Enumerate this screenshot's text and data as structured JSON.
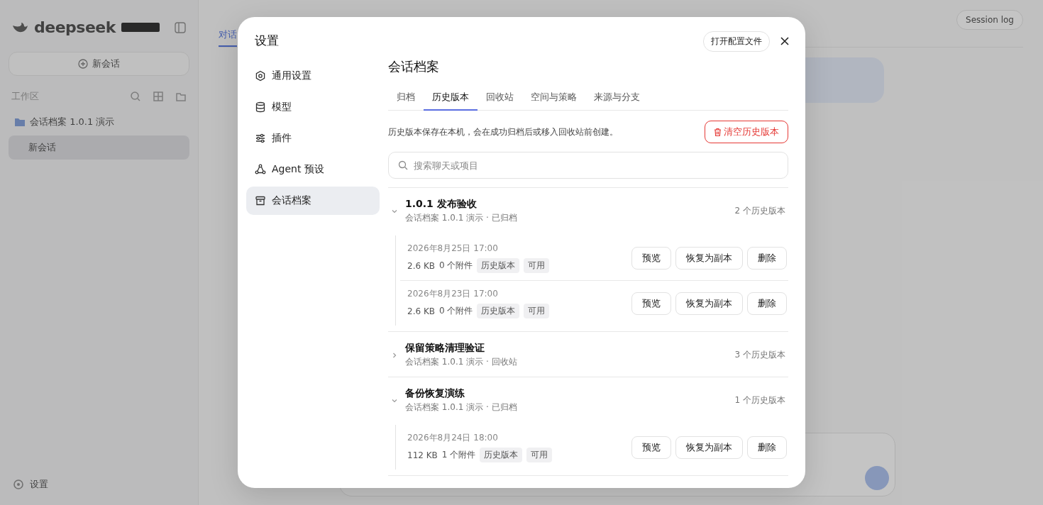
{
  "background": {
    "sidebar": {
      "brand": "deepseek",
      "new_chat": "新会话",
      "workspace_label": "工作区",
      "project": "会话档案 1.0.1 演示",
      "chats": [
        {
          "title": "新会话",
          "selected": true
        }
      ],
      "settings": "设置"
    },
    "main": {
      "tabs": [
        {
          "label": "对话",
          "selected": true
        }
      ],
      "session_log": "Session log"
    }
  },
  "dialog": {
    "title": "设置",
    "open_config": "打开配置文件",
    "nav": [
      {
        "label": "通用设置",
        "selected": false
      },
      {
        "label": "模型",
        "selected": false
      },
      {
        "label": "插件",
        "selected": false
      },
      {
        "label": "Agent 预设",
        "selected": false
      },
      {
        "label": "会话档案",
        "selected": true
      }
    ],
    "heading": "会话档案",
    "tabs": [
      {
        "label": "归档",
        "selected": false
      },
      {
        "label": "历史版本",
        "selected": true
      },
      {
        "label": "回收站",
        "selected": false
      },
      {
        "label": "空间与策略",
        "selected": false
      },
      {
        "label": "来源与分支",
        "selected": false
      }
    ],
    "description": "历史版本保存在本机，会在成功归档后或移入回收站前创建。",
    "clear_button": "清空历史版本",
    "search": {
      "placeholder": "搜索聊天或项目"
    },
    "groups": [
      {
        "title": "1.0.1 发布验收",
        "subtitle": "会话档案 1.0.1 演示 · 已归档",
        "count": "2 个历史版本",
        "expanded": true,
        "versions": [
          {
            "time": "2026年8月25日 17:00",
            "size": "2.6 KB",
            "attachments": "0 个附件",
            "tags": [
              "历史版本",
              "可用"
            ],
            "actions": [
              "预览",
              "恢复为副本",
              "删除"
            ]
          },
          {
            "time": "2026年8月23日 17:00",
            "size": "2.6 KB",
            "attachments": "0 个附件",
            "tags": [
              "历史版本",
              "可用"
            ],
            "actions": [
              "预览",
              "恢复为副本",
              "删除"
            ]
          }
        ]
      },
      {
        "title": "保留策略清理验证",
        "subtitle": "会话档案 1.0.1 演示 · 回收站",
        "count": "3 个历史版本",
        "expanded": false
      },
      {
        "title": "备份恢复演练",
        "subtitle": "会话档案 1.0.1 演示 · 已归档",
        "count": "1 个历史版本",
        "expanded": true,
        "versions": [
          {
            "time": "2026年8月24日 18:00",
            "size": "112 KB",
            "attachments": "1 个附件",
            "tags": [
              "历史版本",
              "可用"
            ],
            "actions": [
              "预览",
              "恢复为副本",
              "删除"
            ]
          }
        ]
      }
    ]
  }
}
